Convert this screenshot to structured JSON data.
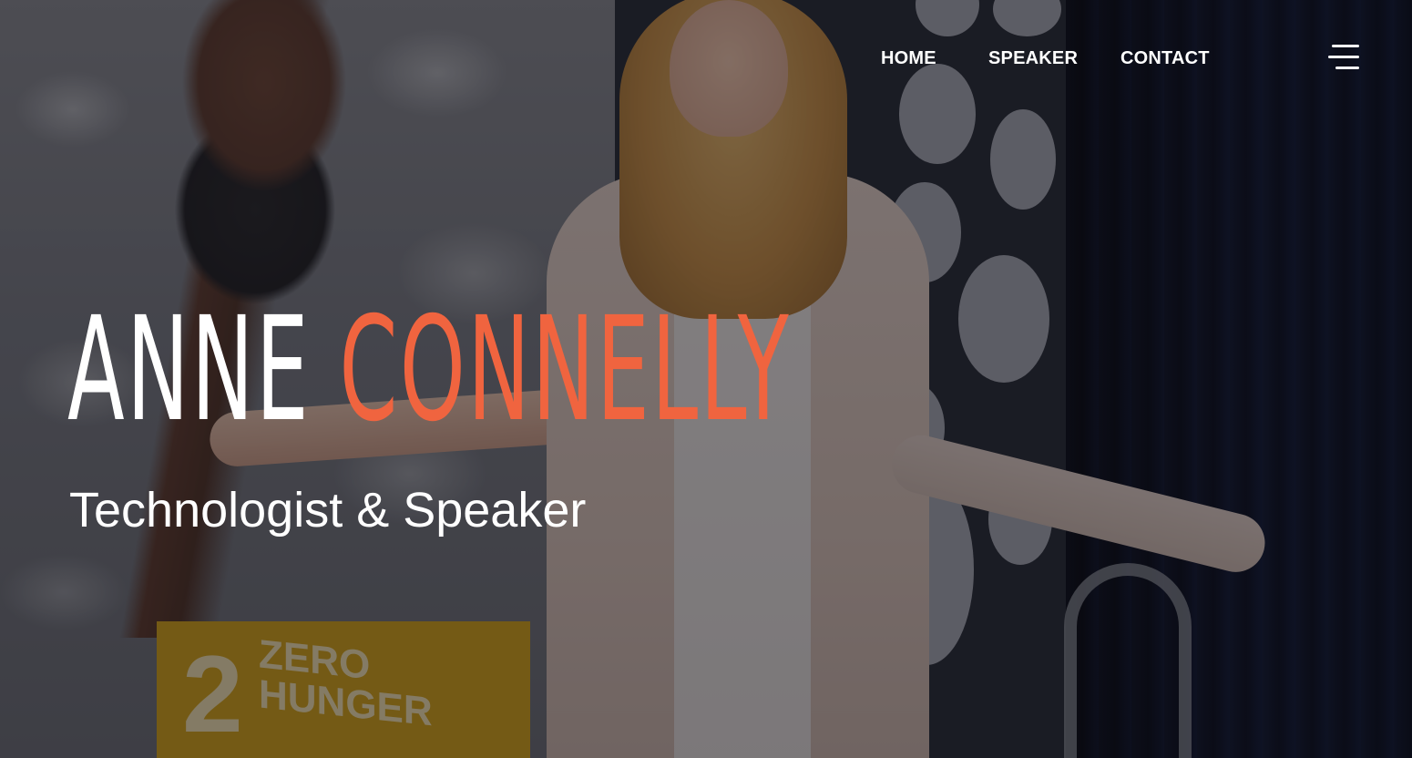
{
  "nav": {
    "home_label": "HOME",
    "speaker_label": "SPEAKER",
    "contact_label": "CONTACT"
  },
  "hero": {
    "first_name": "ANNE",
    "last_name": "CONNELLY",
    "subtitle": "Technologist & Speaker",
    "background_sign": {
      "number": "2",
      "text": "ZERO HUNGER"
    }
  },
  "colors": {
    "accent": "#f0643f",
    "text": "#ffffff",
    "sign_yellow": "#d5a419"
  },
  "icons": {
    "menu": "hamburger-menu-icon"
  }
}
